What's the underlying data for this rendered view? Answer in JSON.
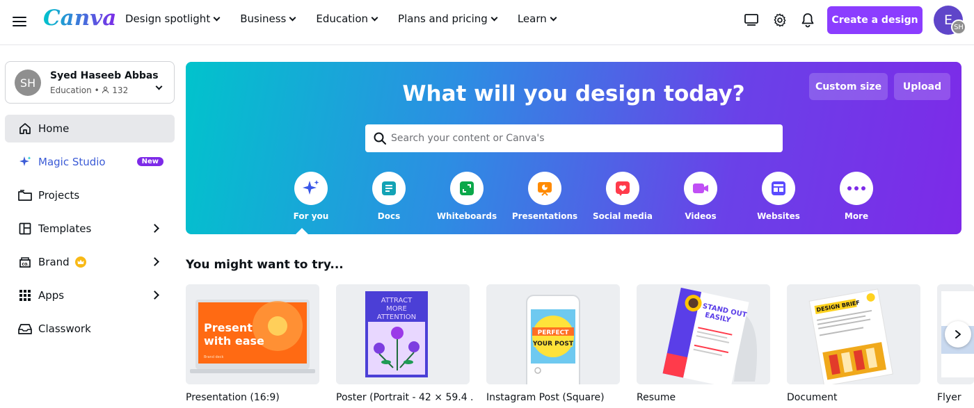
{
  "app": {
    "logo": "Canva"
  },
  "nav": [
    {
      "label": "Design spotlight"
    },
    {
      "label": "Business"
    },
    {
      "label": "Education"
    },
    {
      "label": "Plans and pricing"
    },
    {
      "label": "Learn"
    }
  ],
  "header": {
    "create_label": "Create a design",
    "avatar_initial": "E",
    "avatar_sub": "SH",
    "icons": [
      "monitor-icon",
      "gear-icon",
      "bell-icon"
    ]
  },
  "account": {
    "initials": "SH",
    "name": "Syed Haseeb Abbas",
    "plan": "Education",
    "members": "132"
  },
  "sidebar": {
    "items": [
      {
        "label": "Home",
        "icon": "home-icon"
      },
      {
        "label": "Magic Studio",
        "icon": "sparkle-icon",
        "badge": "New"
      },
      {
        "label": "Projects",
        "icon": "folder-icon"
      },
      {
        "label": "Templates",
        "icon": "templates-icon"
      },
      {
        "label": "Brand",
        "icon": "brand-icon"
      },
      {
        "label": "Apps",
        "icon": "apps-grid-icon"
      },
      {
        "label": "Classwork",
        "icon": "inbox-icon"
      }
    ]
  },
  "hero": {
    "title": "What will you design today?",
    "custom_size_label": "Custom size",
    "upload_label": "Upload",
    "search_placeholder": "Search your content or Canva's",
    "categories": [
      {
        "label": "For you",
        "color": "#3a57e8"
      },
      {
        "label": "Docs",
        "color": "#13a3b5"
      },
      {
        "label": "Whiteboards",
        "color": "#0ba84a"
      },
      {
        "label": "Presentations",
        "color": "#ff8a00"
      },
      {
        "label": "Social media",
        "color": "#ff3b4b"
      },
      {
        "label": "Videos",
        "color": "#c04ff5"
      },
      {
        "label": "Websites",
        "color": "#5a4bff"
      },
      {
        "label": "More",
        "color": "#7d2ae8"
      }
    ]
  },
  "suggestions": {
    "title": "You might want to try...",
    "cards": [
      {
        "label": "Presentation (16:9)",
        "art_title": "Present with ease",
        "art_sub": "Brand deck"
      },
      {
        "label": "Poster (Portrait - 42 × 59.4 ...",
        "art_title": "ATTRACT MORE ATTENTION"
      },
      {
        "label": "Instagram Post (Square)",
        "art_title": "PERFECT YOUR POST"
      },
      {
        "label": "Resume",
        "art_title": "STAND OUT EASILY"
      },
      {
        "label": "Document",
        "art_title": "DESIGN BRIEF"
      },
      {
        "label": "Flyer"
      }
    ]
  },
  "colors": {
    "accent": "#8b3dff",
    "hero_start": "#01c3cc",
    "hero_end": "#7d2ae8"
  }
}
